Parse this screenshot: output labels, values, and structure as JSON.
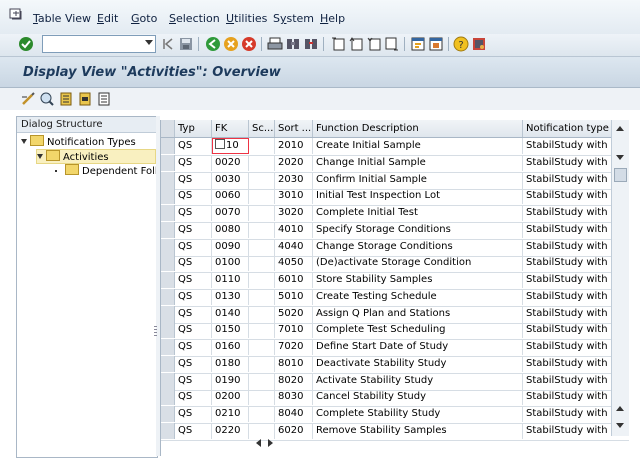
{
  "menu": {
    "items": [
      {
        "pre": "",
        "u": "T",
        "post": "able View"
      },
      {
        "pre": "",
        "u": "E",
        "post": "dit"
      },
      {
        "pre": "",
        "u": "G",
        "post": "oto"
      },
      {
        "pre": "",
        "u": "S",
        "post": "election"
      },
      {
        "pre": "",
        "u": "U",
        "post": "tilities"
      },
      {
        "pre": "S",
        "u": "y",
        "post": "stem"
      },
      {
        "pre": "",
        "u": "H",
        "post": "elp"
      }
    ]
  },
  "toolbar": {
    "command_value": ""
  },
  "page": {
    "title": "Display View \"Activities\": Overview"
  },
  "dialog": {
    "header": "Dialog Structure",
    "tree": [
      "Notification Types",
      "Activities",
      "Dependent Follo"
    ]
  },
  "table": {
    "columns": [
      "Typ",
      "FK",
      "Sc...",
      "Sort ...",
      "Function Description",
      "Notification type"
    ],
    "rows": [
      [
        "QS",
        "10",
        "",
        "2010",
        "Create Initial Sample",
        "StabilStudy with Mat"
      ],
      [
        "QS",
        "0020",
        "",
        "2020",
        "Change Initial Sample",
        "StabilStudy with Mat"
      ],
      [
        "QS",
        "0030",
        "",
        "2030",
        "Confirm Initial Sample",
        "StabilStudy with Mat"
      ],
      [
        "QS",
        "0060",
        "",
        "3010",
        "Initial Test Inspection Lot",
        "StabilStudy with Mat"
      ],
      [
        "QS",
        "0070",
        "",
        "3020",
        "Complete Initial Test",
        "StabilStudy with Mat"
      ],
      [
        "QS",
        "0080",
        "",
        "4010",
        "Specify Storage Conditions",
        "StabilStudy with Mat"
      ],
      [
        "QS",
        "0090",
        "",
        "4040",
        "Change Storage Conditions",
        "StabilStudy with Mat"
      ],
      [
        "QS",
        "0100",
        "",
        "4050",
        "(De)activate Storage Condition",
        "StabilStudy with Mat"
      ],
      [
        "QS",
        "0110",
        "",
        "6010",
        "Store Stability Samples",
        "StabilStudy with Mat"
      ],
      [
        "QS",
        "0130",
        "",
        "5010",
        "Create Testing Schedule",
        "StabilStudy with Mat"
      ],
      [
        "QS",
        "0140",
        "",
        "5020",
        "Assign Q Plan and Stations",
        "StabilStudy with Mat"
      ],
      [
        "QS",
        "0150",
        "",
        "7010",
        "Complete Test Scheduling",
        "StabilStudy with Mat"
      ],
      [
        "QS",
        "0160",
        "",
        "7020",
        "Define Start Date of Study",
        "StabilStudy with Mat"
      ],
      [
        "QS",
        "0180",
        "",
        "8010",
        "Deactivate Stability Study",
        "StabilStudy with Mat"
      ],
      [
        "QS",
        "0190",
        "",
        "8020",
        "Activate Stability Study",
        "StabilStudy with Mat"
      ],
      [
        "QS",
        "0200",
        "",
        "8030",
        "Cancel Stability Study",
        "StabilStudy with Mat"
      ],
      [
        "QS",
        "0210",
        "",
        "8040",
        "Complete Stability Study",
        "StabilStudy with Mat"
      ],
      [
        "QS",
        "0220",
        "",
        "6020",
        "Remove Stability Samples",
        "StabilStudy with Mat"
      ]
    ]
  }
}
